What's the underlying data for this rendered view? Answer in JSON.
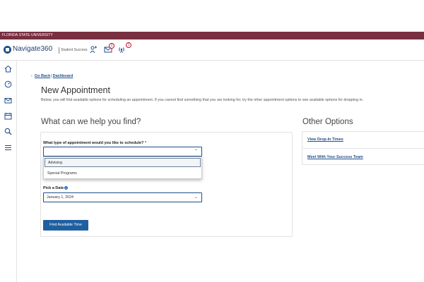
{
  "university_bar": {
    "text": "FLORIDA STATE UNIVERSITY",
    "color": "#782f40"
  },
  "app": {
    "brand": "Navigate360",
    "subtitle": "Student Success",
    "icons": [
      {
        "name": "people-icon",
        "badge": ""
      },
      {
        "name": "mail-icon",
        "badge": "1"
      },
      {
        "name": "broadcast-icon",
        "badge": "1"
      }
    ]
  },
  "sidebar": {
    "icons": [
      "home-icon",
      "dashboard-icon",
      "mail-icon",
      "calendar-icon",
      "search-icon",
      "list-icon"
    ]
  },
  "breadcrumb": {
    "back_label": "Go Back",
    "separator": "|",
    "current": "Dashboard"
  },
  "page": {
    "title": "New Appointment",
    "description": "Below, you will find available options for scheduling an appointment. If you cannot find something that you are looking for, try the other appointment options to see available options for dropping in."
  },
  "main": {
    "heading": "What can we help you find?",
    "type_label": "What type of appointment would you like to schedule?",
    "required_mark": "*",
    "type_value": "",
    "options": [
      "Advising",
      "Special Programs"
    ],
    "highlighted_option": "Advising",
    "date_label": "Pick a Date",
    "date_value": "January 1, 2024",
    "find_button": "Find Available Time"
  },
  "other_options": {
    "heading": "Other Options",
    "links": [
      "View Drop-In Times",
      "Meet With Your Success Team"
    ]
  },
  "colors": {
    "accent": "#1f4e8c",
    "button": "#1f5fa0",
    "required": "#c8102e"
  }
}
